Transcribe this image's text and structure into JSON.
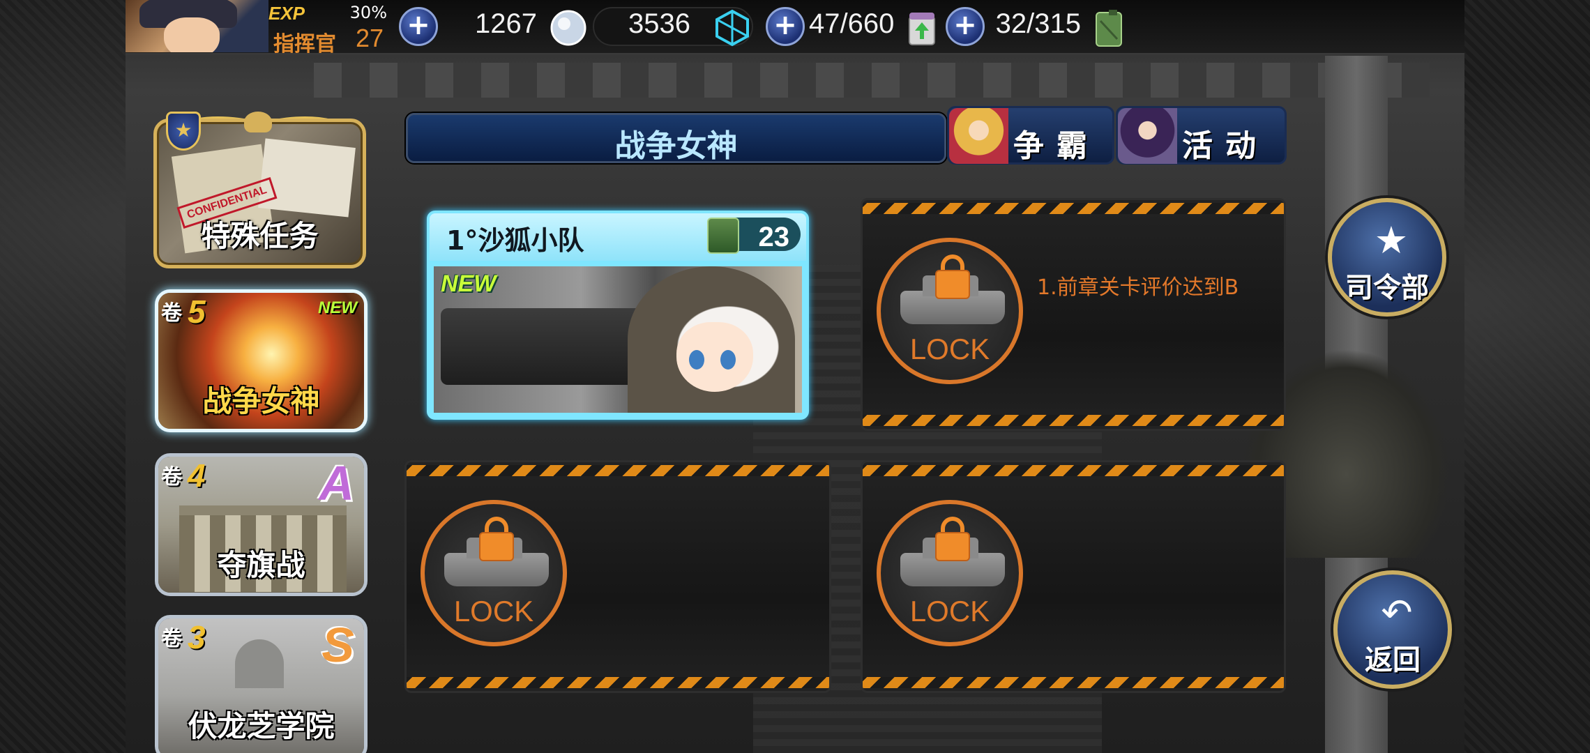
{
  "topbar": {
    "exp_label": "EXP",
    "exp_percent": "30%",
    "rank_label": "指挥官",
    "rank_level": "27",
    "resources": [
      {
        "id": "silver",
        "value": "1267",
        "icon": "silver-coin-icon"
      },
      {
        "id": "crystal",
        "value": "3536",
        "icon": "crystal-cube-icon"
      },
      {
        "id": "paint",
        "value": "47/660",
        "icon": "paint-can-icon"
      },
      {
        "id": "fuel",
        "value": "32/315",
        "icon": "fuel-canister-icon"
      }
    ],
    "plus_symbol": "+"
  },
  "left_menu": {
    "special": {
      "label": "特殊任务",
      "stamp": "CONFIDENTIAL"
    },
    "chapters": [
      {
        "vol_prefix": "卷",
        "vol_num": "5",
        "name": "战争女神",
        "badge": "NEW",
        "active": true
      },
      {
        "vol_prefix": "卷",
        "vol_num": "4",
        "name": "夺旗战",
        "grade": "A"
      },
      {
        "vol_prefix": "卷",
        "vol_num": "3",
        "name": "伏龙芝学院",
        "grade": "S"
      }
    ]
  },
  "tabs": {
    "title": "战争女神",
    "compete": "争霸",
    "event": "活动"
  },
  "stages": {
    "active": {
      "name": "1°沙狐小队",
      "cost": "23",
      "badge": "NEW"
    },
    "locked_label": "LOCK",
    "requirement": "1.前章关卡评价达到B"
  },
  "right_buttons": {
    "hq": "司令部",
    "back": "返回"
  },
  "colors": {
    "accent_orange": "#e3782a",
    "active_cyan": "#7fe6ff",
    "tab_blue": "#1a3a6d",
    "gold": "#d6b15a"
  }
}
